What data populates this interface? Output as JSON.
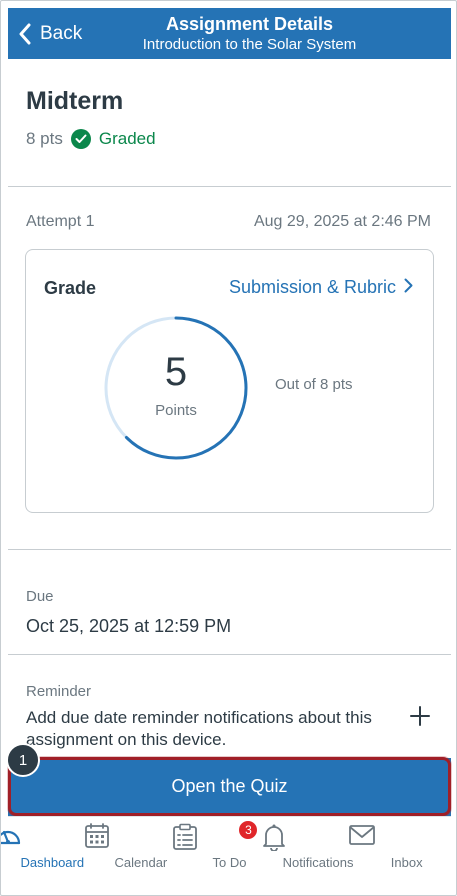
{
  "header": {
    "back_label": "Back",
    "title": "Assignment Details",
    "subtitle": "Introduction to the Solar System"
  },
  "assignment": {
    "name": "Midterm",
    "points": "8 pts",
    "status": "Graded"
  },
  "attempt": {
    "label": "Attempt 1",
    "date": "Aug 29, 2025 at 2:46 PM"
  },
  "grade": {
    "title": "Grade",
    "rubric_link": "Submission & Rubric",
    "score": "5",
    "score_label": "Points",
    "out_of": "Out of 8 pts",
    "score_fraction": 0.625
  },
  "due": {
    "label": "Due",
    "value": "Oct 25, 2025 at 12:59 PM"
  },
  "reminder": {
    "label": "Reminder",
    "text": "Add due date reminder notifications about this assignment on this device."
  },
  "quiz_button": {
    "label": "Open the Quiz",
    "step": "1"
  },
  "tabs": [
    {
      "label": "Dashboard",
      "icon": "dashboard-icon"
    },
    {
      "label": "Calendar",
      "icon": "calendar-icon"
    },
    {
      "label": "To Do",
      "icon": "todo-icon",
      "badge": "3"
    },
    {
      "label": "Notifications",
      "icon": "bell-icon"
    },
    {
      "label": "Inbox",
      "icon": "mail-icon"
    }
  ],
  "colors": {
    "brand": "#2573b5",
    "success": "#0b874b",
    "highlight": "#a01f27",
    "badge": "#e0262a"
  }
}
